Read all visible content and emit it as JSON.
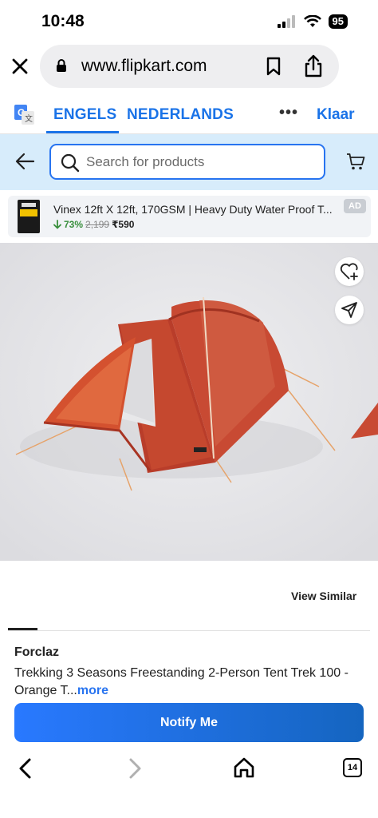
{
  "status": {
    "time": "10:48",
    "battery": "95"
  },
  "browser": {
    "url": "www.flipkart.com"
  },
  "translate": {
    "lang_source": "ENGELS",
    "lang_target": "NEDERLANDS",
    "more": "•••",
    "done": "Klaar"
  },
  "search": {
    "placeholder": "Search for products"
  },
  "ad": {
    "title": "Vinex 12ft X 12ft, 170GSM | Heavy Duty Water Proof T...",
    "discount": "73%",
    "mrp": "2,199",
    "price": "₹590",
    "badge": "AD"
  },
  "product": {
    "view_similar": "View Similar",
    "brand": "Forclaz",
    "name": "Trekking 3 Seasons Freestanding 2-Person Tent Trek 100 - Orange T...",
    "more": "more",
    "notify": "Notify Me"
  },
  "toolbar": {
    "tab_count": "14"
  },
  "colors": {
    "accent": "#2874f0",
    "header_bg": "#d7ecfb",
    "discount": "#388e3c"
  }
}
